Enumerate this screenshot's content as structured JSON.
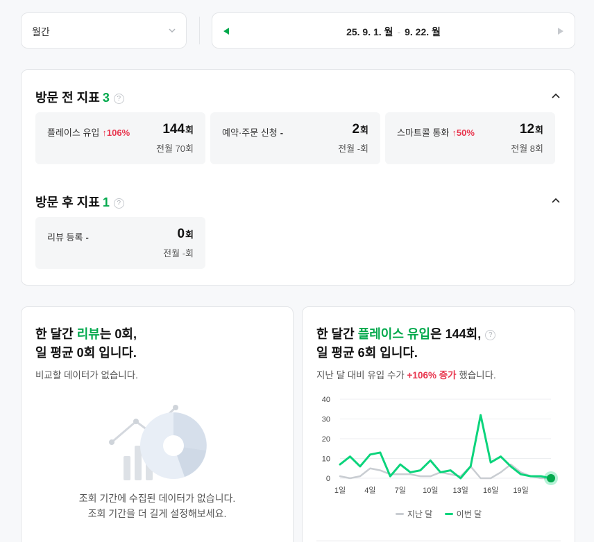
{
  "colors": {
    "accent_green": "#03a94d",
    "increase_red": "#e8374f",
    "last_month_gray": "#c9cdd2"
  },
  "period": {
    "label": "월간",
    "icon": "chevron-down-icon"
  },
  "date_range": {
    "start": "25. 9. 1. 월",
    "separator": "-",
    "end": "9. 22. 월",
    "prev_icon": "triangle-left-icon",
    "next_icon": "triangle-right-icon"
  },
  "pre_visit": {
    "title": "방문 전 지표",
    "count": "3",
    "help": "?",
    "metrics": [
      {
        "name": "플레이스 유입",
        "change": "↑106%",
        "value": "144",
        "unit": "회",
        "prev": "전월 70회"
      },
      {
        "name": "예약·주문 신청",
        "change": "-",
        "value": "2",
        "unit": "회",
        "prev": "전월 -회"
      },
      {
        "name": "스마트콜 통화",
        "change": "↑50%",
        "value": "12",
        "unit": "회",
        "prev": "전월 8회"
      }
    ]
  },
  "post_visit": {
    "title": "방문 후 지표",
    "count": "1",
    "help": "?",
    "metrics": [
      {
        "name": "리뷰 등록",
        "change": "-",
        "value": "0",
        "unit": "회",
        "prev": "전월 -회"
      }
    ]
  },
  "review_card": {
    "line1_pre": "한 달간 ",
    "line1_hl": "리뷰",
    "line1_post": "는 0회,",
    "line2": "일 평균 0회 입니다.",
    "sub": "비교할 데이터가 없습니다.",
    "empty_line1": "조회 기간에 수집된 데이터가 없습니다.",
    "empty_line2": "조회 기간을 더 길게 설정해보세요."
  },
  "inflow_card": {
    "line1_pre": "한 달간 ",
    "line1_hl": "플레이스 유입",
    "line1_post": "은 144회,",
    "line2": "일 평균 6회 입니다.",
    "sub_pre": "지난 달 대비 유입 수가 ",
    "sub_hl": "+106% 증가",
    "sub_post": " 했습니다.",
    "help": "?"
  },
  "chart_data": {
    "type": "line",
    "x": [
      1,
      2,
      3,
      4,
      5,
      6,
      7,
      8,
      9,
      10,
      11,
      12,
      13,
      14,
      15,
      16,
      17,
      18,
      19,
      20,
      21,
      22
    ],
    "x_ticks": [
      "1일",
      "4일",
      "7일",
      "10일",
      "13일",
      "16일",
      "19일"
    ],
    "x_tick_values": [
      1,
      4,
      7,
      10,
      13,
      16,
      19
    ],
    "ylim": [
      0,
      40
    ],
    "y_ticks": [
      "0",
      "10",
      "20",
      "30",
      "40"
    ],
    "grid": true,
    "legend_position": "bottom",
    "series": [
      {
        "name": "지난 달",
        "color": "#c9cdd2",
        "values": [
          1,
          0,
          1,
          5,
          4,
          2,
          2,
          2,
          1,
          1,
          3,
          2,
          1,
          6,
          0,
          0,
          3,
          7,
          3,
          1,
          0,
          0
        ]
      },
      {
        "name": "이번 달",
        "color": "#0cd47c",
        "values": [
          7,
          11,
          6,
          12,
          13,
          1,
          7,
          3,
          4,
          9,
          3,
          4,
          0,
          6,
          32,
          8,
          11,
          6,
          2,
          1,
          1,
          0
        ]
      }
    ]
  }
}
